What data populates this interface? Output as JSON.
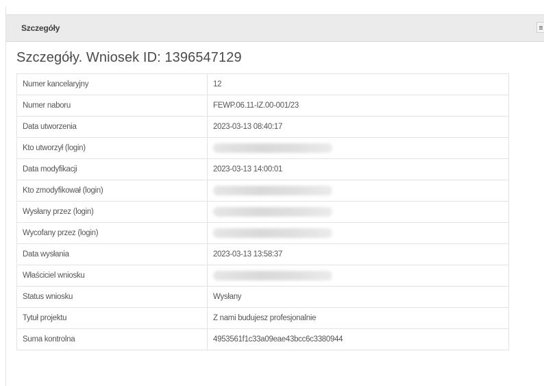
{
  "panel": {
    "title": "Szczegóły"
  },
  "page": {
    "title": "Szczegóły. Wniosek ID: 1396547129"
  },
  "details": [
    {
      "label": "Numer kancelaryjny",
      "value": "12",
      "redacted": false
    },
    {
      "label": "Numer naboru",
      "value": "FEWP.06.11-IZ.00-001/23",
      "redacted": false
    },
    {
      "label": "Data utworzenia",
      "value": "2023-03-13 08:40:17",
      "redacted": false
    },
    {
      "label": "Kto utworzył (login)",
      "value": "",
      "redacted": true
    },
    {
      "label": "Data modyfikacji",
      "value": "2023-03-13 14:00:01",
      "redacted": false
    },
    {
      "label": "Kto zmodyfikował (login)",
      "value": "",
      "redacted": true
    },
    {
      "label": "Wysłany przez (login)",
      "value": "",
      "redacted": true
    },
    {
      "label": "Wycofany przez (login)",
      "value": "",
      "redacted": true
    },
    {
      "label": "Data wysłania",
      "value": "2023-03-13 13:58:37",
      "redacted": false
    },
    {
      "label": "Właściciel wniosku",
      "value": "",
      "redacted": true
    },
    {
      "label": "Status wniosku",
      "value": "Wysłany",
      "redacted": false
    },
    {
      "label": "Tytuł projektu",
      "value": "Z nami budujesz profesjonalnie",
      "redacted": false
    },
    {
      "label": "Suma kontrolna",
      "value": "4953561f1c33a09eae43bcc6c3380944",
      "redacted": false
    }
  ]
}
